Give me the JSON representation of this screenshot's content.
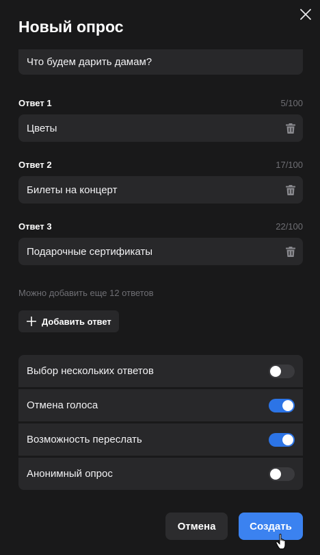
{
  "dialog": {
    "title": "Новый опрос",
    "close_icon": "close-icon"
  },
  "question": {
    "value": "Что будем дарить дамам?"
  },
  "answers": [
    {
      "label": "Ответ 1",
      "counter": "5/100",
      "value": "Цветы",
      "icon": "trash-icon"
    },
    {
      "label": "Ответ 2",
      "counter": "17/100",
      "value": "Билеты на концерт",
      "icon": "trash-icon"
    },
    {
      "label": "Ответ 3",
      "counter": "22/100",
      "value": "Подарочные сертификаты",
      "icon": "trash-icon"
    }
  ],
  "hint": "Можно добавить еще 12 ответов",
  "add_answer": {
    "label": "Добавить ответ",
    "icon": "plus-icon"
  },
  "settings": [
    {
      "label": "Выбор нескольких ответов",
      "enabled": false
    },
    {
      "label": "Отмена голоса",
      "enabled": true
    },
    {
      "label": "Возможность переслать",
      "enabled": true
    },
    {
      "label": "Анонимный опрос",
      "enabled": false
    }
  ],
  "footer": {
    "cancel_label": "Отмена",
    "create_label": "Создать"
  },
  "colors": {
    "background": "#19191a",
    "surface": "#28282a",
    "accent": "#3b82f0",
    "toggle_on": "#2c74e6",
    "toggle_off": "#3a3a3d",
    "muted_text": "#6f6f74"
  }
}
